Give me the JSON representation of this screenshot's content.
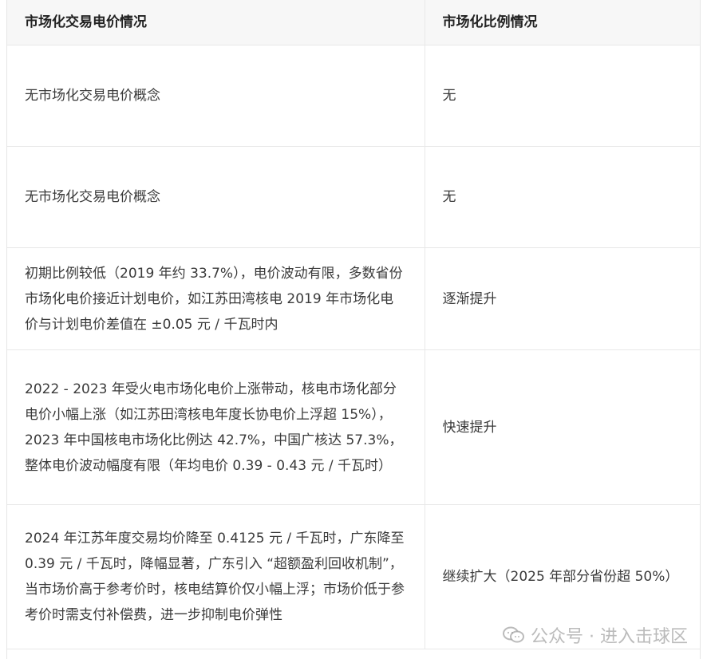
{
  "table": {
    "headers": [
      "市场化交易电价情况",
      "市场化比例情况"
    ],
    "rows": [
      {
        "price": "无市场化交易电价概念",
        "ratio": "无"
      },
      {
        "price": "无市场化交易电价概念",
        "ratio": "无"
      },
      {
        "price": "初期比例较低（2019 年约 33.7%），电价波动有限，多数省份市场化电价接近计划电价，如江苏田湾核电 2019 年市场化电价与计划电价差值在 ±0.05 元 / 千瓦时内",
        "ratio": "逐渐提升"
      },
      {
        "price": "2022 - 2023 年受火电市场化电价上涨带动，核电市场化部分电价小幅上涨（如江苏田湾核电年度长协电价上浮超 15%），2023 年中国核电市场化比例达 42.7%，中国广核达 57.3%，整体电价波动幅度有限（年均电价 0.39 - 0.43 元 / 千瓦时）",
        "ratio": "快速提升"
      },
      {
        "price": "2024 年江苏年度交易均价降至 0.4125 元 / 千瓦时，广东降至 0.39 元 / 千瓦时，降幅显著，广东引入 “超额盈利回收机制”，当市场价高于参考价时，核电结算价仅小幅上浮；市场价低于参考价时需支付补偿费，进一步抑制电价弹性",
        "ratio": "继续扩大（2025 年部分省份超 50%）"
      }
    ]
  },
  "watermark": {
    "text": "公众号 · 进入击球区",
    "icon": "wechat-icon"
  }
}
